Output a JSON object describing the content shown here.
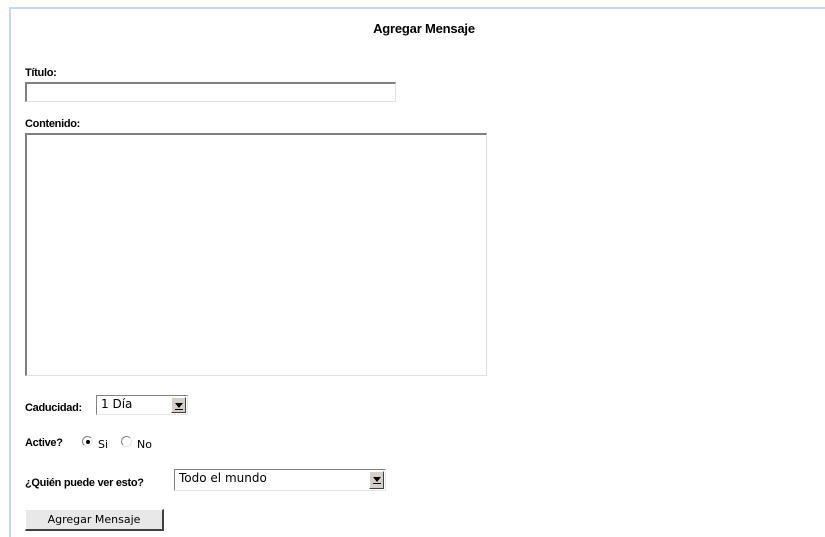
{
  "form": {
    "heading": "Agregar Mensaje",
    "title_label": "Título:",
    "title_value": "",
    "content_label": "Contenido:",
    "content_value": "",
    "expiry_label": "Caducidad:",
    "expiry_selected": "1 Día",
    "active_label": "Active?",
    "active_options": [
      {
        "label": "Si",
        "checked": true
      },
      {
        "label": "No",
        "checked": false
      }
    ],
    "visibility_label": "¿Quién puede ver esto?",
    "visibility_selected": "Todo el mundo",
    "submit_label": "Agregar Mensaje"
  }
}
